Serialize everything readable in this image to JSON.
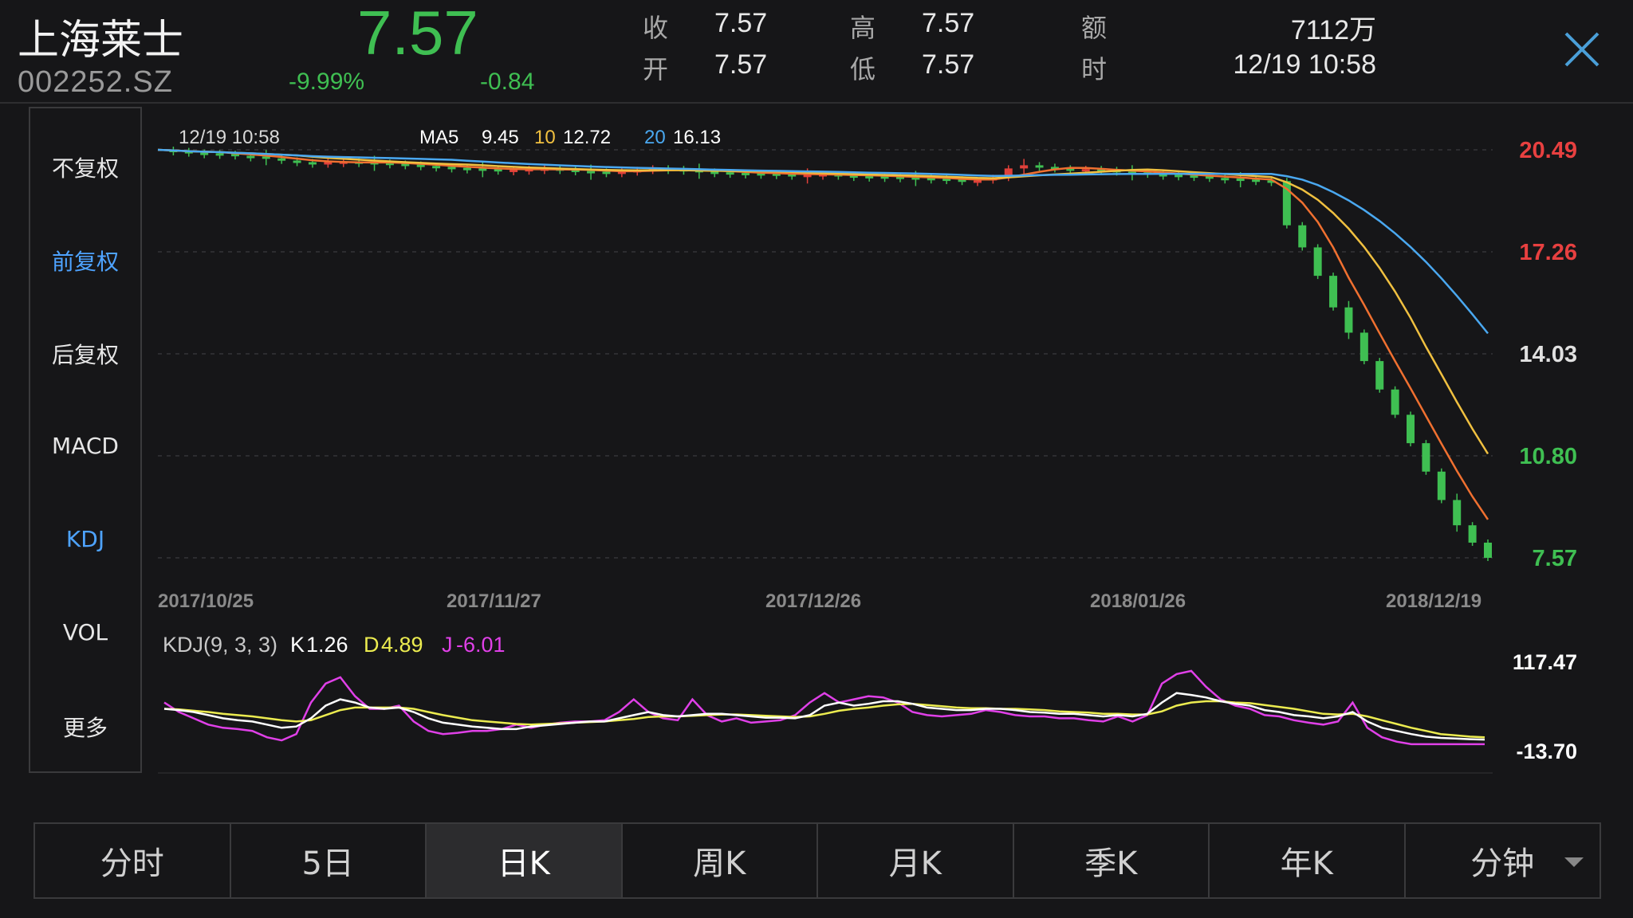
{
  "stock": {
    "name": "上海莱士",
    "code": "002252.SZ",
    "price": "7.57",
    "change_pct": "-9.99%",
    "change": "-0.84"
  },
  "quote": {
    "close_label": "收",
    "close_value": "7.57",
    "open_label": "开",
    "open_value": "7.57",
    "high_label": "高",
    "high_value": "7.57",
    "low_label": "低",
    "low_value": "7.57",
    "amount_label": "额",
    "amount_value": "7112万",
    "time_label": "时",
    "time_value": "12/19 10:58"
  },
  "sidebar": {
    "items": [
      {
        "label": "不复权",
        "active": false
      },
      {
        "label": "前复权",
        "active": true
      },
      {
        "label": "后复权",
        "active": false
      },
      {
        "label": "MACD",
        "active": false
      },
      {
        "label": "KDJ",
        "active": true
      },
      {
        "label": "VOL",
        "active": false
      },
      {
        "label": "更多",
        "active": false
      }
    ]
  },
  "tabs": [
    {
      "label": "分时",
      "active": false
    },
    {
      "label": "5日",
      "active": false
    },
    {
      "label": "日K",
      "active": true
    },
    {
      "label": "周K",
      "active": false
    },
    {
      "label": "月K",
      "active": false
    },
    {
      "label": "季K",
      "active": false
    },
    {
      "label": "年K",
      "active": false
    },
    {
      "label": "分钟",
      "active": false,
      "dropdown": true
    }
  ],
  "colors": {
    "up": "#e0403a",
    "down": "#3fbf52",
    "ma5": "#f07030",
    "ma10": "#f0c040",
    "ma20": "#4aa8f0",
    "k": "#ffffff",
    "d": "#ecec50",
    "j": "#e040e8",
    "accent": "#4ea3ff"
  },
  "chart_data": [
    {
      "type": "candlestick",
      "title": "",
      "cursor_time": "12/19 10:58",
      "legend": [
        {
          "label": "MA5",
          "value": "9.45"
        },
        {
          "label": "10",
          "value": "12.72"
        },
        {
          "label": "20",
          "value": "16.13"
        }
      ],
      "y_ticks": [
        "20.49",
        "17.26",
        "14.03",
        "10.80",
        "7.57"
      ],
      "ylim": [
        7.57,
        20.49
      ],
      "x_ticks": [
        "2017/10/25",
        "2017/11/27",
        "2017/12/26",
        "2018/01/26",
        "2018/12/19"
      ],
      "price_path": [
        20.49,
        20.45,
        20.4,
        20.38,
        20.36,
        20.3,
        20.28,
        20.22,
        20.15,
        20.1,
        20.05,
        20.1,
        20.12,
        20.1,
        20.08,
        20.05,
        20.02,
        19.98,
        19.95,
        19.92,
        19.9,
        19.88,
        19.85,
        19.86,
        19.88,
        19.9,
        19.86,
        19.82,
        19.8,
        19.78,
        19.8,
        19.85,
        19.9,
        19.88,
        19.85,
        19.8,
        19.78,
        19.76,
        19.75,
        19.74,
        19.72,
        19.7,
        19.7,
        19.72,
        19.68,
        19.66,
        19.65,
        19.64,
        19.62,
        19.6,
        19.58,
        19.55,
        19.5,
        19.52,
        19.6,
        19.9,
        20.0,
        19.95,
        19.9,
        19.85,
        19.88,
        19.85,
        19.8,
        19.78,
        19.72,
        19.7,
        19.68,
        19.65,
        19.6,
        19.58,
        19.55,
        19.52,
        19.5,
        18.1,
        17.4,
        16.5,
        15.5,
        14.7,
        13.8,
        12.9,
        12.1,
        11.2,
        10.3,
        9.4,
        8.6,
        8.05,
        7.57
      ],
      "ma5_end": "9.45",
      "ma10_end": "12.72",
      "ma20_end": "16.13"
    },
    {
      "type": "line",
      "title": "KDJ(9, 3, 3)",
      "series": [
        {
          "name": "K",
          "value": "1.26"
        },
        {
          "name": "D",
          "value": "4.89"
        },
        {
          "name": "J",
          "value": "-6.01"
        }
      ],
      "y_ticks": [
        "117.47",
        "-13.70"
      ],
      "ylim": [
        -13.7,
        117.47
      ],
      "k": [
        50,
        48,
        45,
        40,
        35,
        32,
        30,
        25,
        20,
        22,
        35,
        55,
        65,
        60,
        52,
        50,
        52,
        45,
        35,
        28,
        25,
        22,
        20,
        18,
        18,
        22,
        24,
        26,
        28,
        30,
        30,
        35,
        40,
        45,
        40,
        38,
        40,
        42,
        42,
        40,
        38,
        36,
        36,
        35,
        40,
        55,
        60,
        55,
        58,
        62,
        62,
        58,
        52,
        50,
        48,
        48,
        50,
        50,
        48,
        45,
        44,
        42,
        42,
        40,
        38,
        40,
        38,
        42,
        60,
        75,
        72,
        68,
        62,
        58,
        55,
        48,
        45,
        40,
        38,
        35,
        38,
        45,
        30,
        20,
        15,
        10,
        6,
        4,
        3,
        2,
        1.26
      ],
      "d": [
        50,
        49,
        47,
        45,
        42,
        40,
        38,
        35,
        32,
        30,
        32,
        40,
        48,
        52,
        52,
        52,
        52,
        50,
        45,
        40,
        36,
        32,
        30,
        28,
        26,
        25,
        26,
        27,
        28,
        29,
        30,
        32,
        34,
        37,
        38,
        38,
        39,
        40,
        41,
        41,
        40,
        39,
        38,
        37,
        38,
        42,
        47,
        50,
        52,
        55,
        57,
        58,
        56,
        54,
        52,
        51,
        51,
        50,
        50,
        49,
        48,
        46,
        45,
        44,
        42,
        42,
        41,
        41,
        46,
        55,
        60,
        62,
        62,
        60,
        59,
        56,
        53,
        50,
        46,
        42,
        41,
        42,
        38,
        32,
        26,
        20,
        15,
        10,
        8,
        6,
        4.89
      ],
      "j": [
        60,
        45,
        35,
        25,
        20,
        18,
        15,
        5,
        0,
        10,
        60,
        90,
        100,
        70,
        50,
        50,
        55,
        30,
        15,
        10,
        12,
        15,
        15,
        18,
        25,
        20,
        25,
        28,
        30,
        30,
        32,
        45,
        65,
        45,
        35,
        32,
        65,
        40,
        30,
        35,
        28,
        30,
        32,
        40,
        60,
        75,
        60,
        65,
        70,
        68,
        60,
        45,
        40,
        38,
        40,
        42,
        48,
        45,
        40,
        38,
        38,
        35,
        35,
        32,
        30,
        38,
        30,
        40,
        90,
        105,
        110,
        85,
        65,
        55,
        50,
        40,
        38,
        32,
        28,
        25,
        30,
        60,
        20,
        5,
        -2,
        -6,
        -6,
        -6,
        -6,
        -6,
        -6.01
      ]
    }
  ]
}
